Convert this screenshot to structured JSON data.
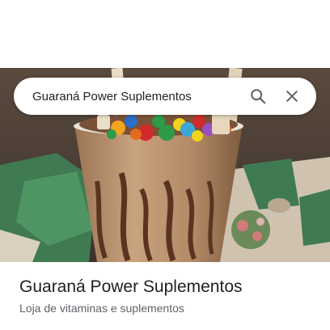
{
  "search": {
    "query": "Guaraná Power Suplementos",
    "search_icon": "search-icon",
    "clear_icon": "close-icon"
  },
  "hero_photo": {
    "subject": "milkshake cup topped with candy-coated chocolates and wafer sticks"
  },
  "place": {
    "name": "Guaraná Power Suplementos",
    "category": "Loja de vitaminas e suplementos"
  },
  "colors": {
    "text_primary": "#202124",
    "text_secondary": "#5f6368",
    "icon": "#5f6368"
  }
}
